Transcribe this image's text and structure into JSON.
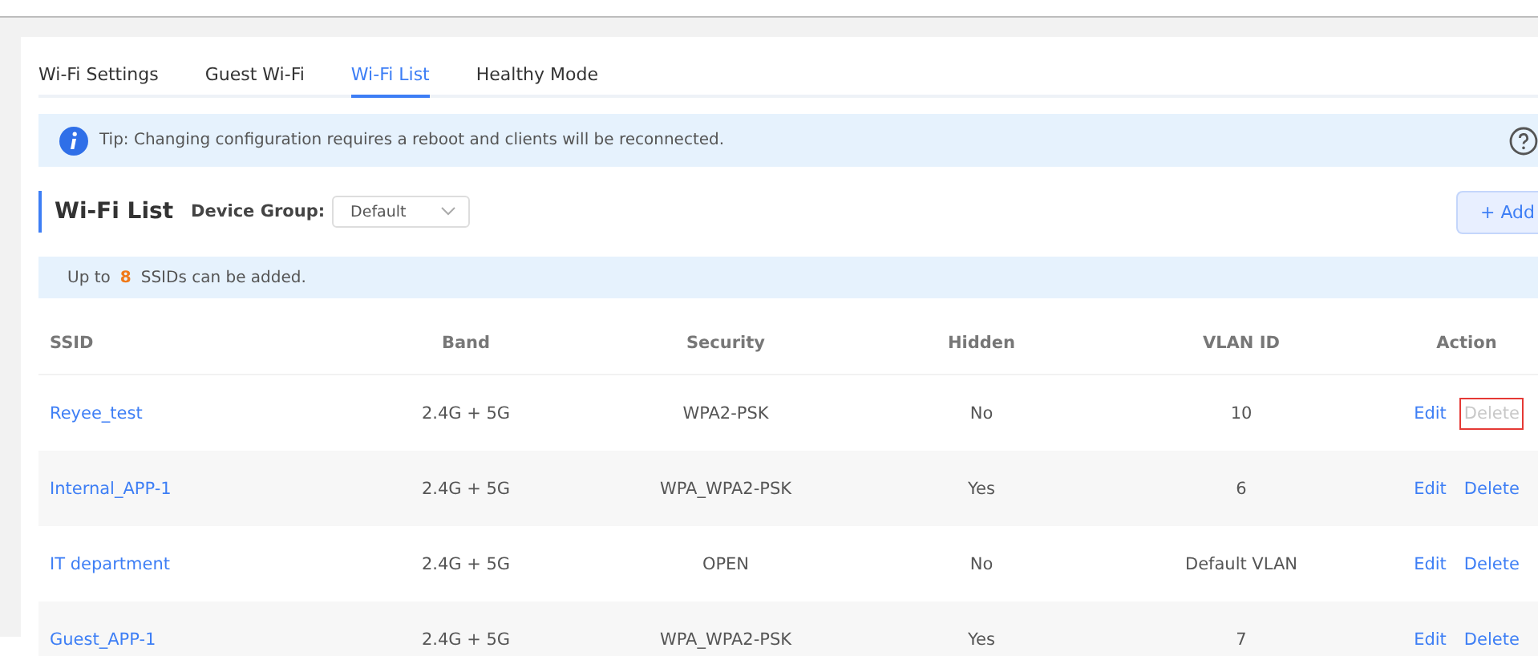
{
  "tabs": [
    {
      "label": "Wi-Fi Settings",
      "selected": false
    },
    {
      "label": "Guest Wi-Fi",
      "selected": false
    },
    {
      "label": "Wi-Fi List",
      "selected": true
    },
    {
      "label": "Healthy Mode",
      "selected": false
    }
  ],
  "tip": {
    "text": "Tip: Changing configuration requires a reboot and clients will be reconnected."
  },
  "section": {
    "title": "Wi-Fi List",
    "device_group_label": "Device Group:",
    "device_group_value": "Default",
    "add_button": "+ Add"
  },
  "limit_note": {
    "before": "Up to",
    "count": "8",
    "after": "SSIDs can be added."
  },
  "table": {
    "columns": [
      "SSID",
      "Band",
      "Security",
      "Hidden",
      "VLAN ID",
      "Action"
    ],
    "rows": [
      {
        "ssid": "Reyee_test",
        "band": "2.4G + 5G",
        "security": "WPA2-PSK",
        "hidden": "No",
        "vlan": "10",
        "actions": [
          {
            "label": "Edit",
            "disabled": false,
            "highlighted": false
          },
          {
            "label": "Delete",
            "disabled": true,
            "highlighted": true
          }
        ]
      },
      {
        "ssid": "Internal_APP-1",
        "band": "2.4G + 5G",
        "security": "WPA_WPA2-PSK",
        "hidden": "Yes",
        "vlan": "6",
        "actions": [
          {
            "label": "Edit",
            "disabled": false,
            "highlighted": false
          },
          {
            "label": "Delete",
            "disabled": false,
            "highlighted": false
          }
        ]
      },
      {
        "ssid": "IT department",
        "band": "2.4G + 5G",
        "security": "OPEN",
        "hidden": "No",
        "vlan": "Default VLAN",
        "actions": [
          {
            "label": "Edit",
            "disabled": false,
            "highlighted": false
          },
          {
            "label": "Delete",
            "disabled": false,
            "highlighted": false
          }
        ]
      },
      {
        "ssid": "Guest_APP-1",
        "band": "2.4G + 5G",
        "security": "WPA_WPA2-PSK",
        "hidden": "Yes",
        "vlan": "7",
        "actions": [
          {
            "label": "Edit",
            "disabled": false,
            "highlighted": false
          },
          {
            "label": "Delete",
            "disabled": false,
            "highlighted": false
          }
        ]
      }
    ]
  }
}
